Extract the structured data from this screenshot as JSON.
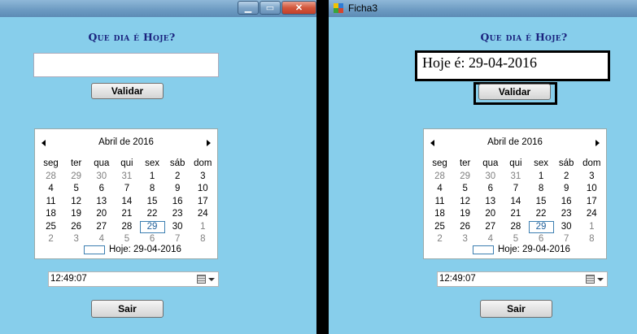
{
  "left_window": {
    "heading": "Que dia é Hoje?",
    "input_value": "",
    "validate_label": "Validar",
    "exit_label": "Sair",
    "time_value": "12:49:07"
  },
  "right_window": {
    "title": "Ficha3",
    "heading": "Que dia é Hoje?",
    "result_text": "Hoje é: 29-04-2016",
    "validate_label": "Validar",
    "exit_label": "Sair",
    "time_value": "12:49:07"
  },
  "calendar": {
    "month_label": "Abril de 2016",
    "weekdays": [
      "seg",
      "ter",
      "qua",
      "qui",
      "sex",
      "sáb",
      "dom"
    ],
    "weeks": [
      [
        "28",
        "29",
        "30",
        "31",
        "1",
        "2",
        "3"
      ],
      [
        "4",
        "5",
        "6",
        "7",
        "8",
        "9",
        "10"
      ],
      [
        "11",
        "12",
        "13",
        "14",
        "15",
        "16",
        "17"
      ],
      [
        "18",
        "19",
        "20",
        "21",
        "22",
        "23",
        "24"
      ],
      [
        "25",
        "26",
        "27",
        "28",
        "29",
        "30",
        "1"
      ],
      [
        "2",
        "3",
        "4",
        "5",
        "6",
        "7",
        "8"
      ]
    ],
    "today_label": "Hoje: 29-04-2016"
  },
  "window_controls": {
    "minimize": "▁",
    "maximize": "▭",
    "close": "✕"
  }
}
